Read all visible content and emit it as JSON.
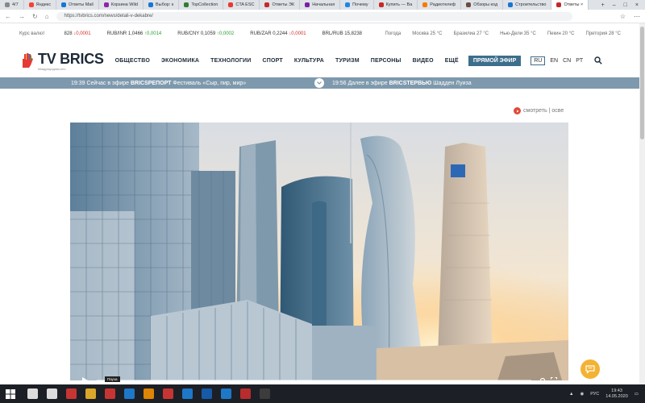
{
  "browser": {
    "tabs": [
      {
        "label": "4/7",
        "color": "#888888"
      },
      {
        "label": "Яндекс",
        "color": "#f44336"
      },
      {
        "label": "Ответы Mail",
        "color": "#1976d2"
      },
      {
        "label": "Корзина Wild",
        "color": "#8e24aa"
      },
      {
        "label": "Выбор: к",
        "color": "#1976d2"
      },
      {
        "label": "TopCollection",
        "color": "#2e7d32"
      },
      {
        "label": "CTA ESC",
        "color": "#e53935"
      },
      {
        "label": "Ответы ЭК",
        "color": "#c62828"
      },
      {
        "label": "Начальная",
        "color": "#7b1fa2"
      },
      {
        "label": "Почему",
        "color": "#1e88e5"
      },
      {
        "label": "Купить — Ва",
        "color": "#c62828"
      },
      {
        "label": "Радиотелеф",
        "color": "#f57c00"
      },
      {
        "label": "Обзоры код",
        "color": "#6d4c41"
      },
      {
        "label": "Строительство",
        "color": "#1976d2"
      },
      {
        "label": "Ответы ×",
        "color": "#c62828",
        "active": true
      }
    ],
    "url": "https://tvbrics.com/news/detali-v-dekabre/"
  },
  "rates": {
    "label": "Курс валют",
    "items": [
      {
        "code": "828",
        "delta": "↓0,0001",
        "dir": "down"
      },
      {
        "code": "RUB/INR 1,0466",
        "delta": "↑0,0014",
        "dir": "up"
      },
      {
        "code": "RUB/CNY 0,1059",
        "delta": "↑0,0002",
        "dir": "up"
      },
      {
        "code": "RUB/ZAR 0,2244",
        "delta": "↓0,0001",
        "dir": "down"
      },
      {
        "code": "BRL/RUB 15,8238",
        "delta": "",
        "dir": ""
      }
    ],
    "weather_label": "Погода",
    "weather": [
      "Москва 25 °C",
      "Бразилиа 27 °C",
      "Нью-Дели 35 °C",
      "Пекин 20 °C",
      "Претория 28 °C"
    ]
  },
  "header": {
    "logo_text": "TV BRICS",
    "logo_sub": "Международная сеть",
    "menu": [
      "ОБЩЕСТВО",
      "ЭКОНОМИКА",
      "ТЕХНОЛОГИИ",
      "СПОРТ",
      "КУЛЬТУРА",
      "ТУРИЗМ",
      "ПЕРСОНЫ",
      "ВИДЕО",
      "ЕЩЁ"
    ],
    "live_label": "ПРЯМОЙ ЭФИР",
    "langs": [
      "RU",
      "EN",
      "CN",
      "PT"
    ]
  },
  "ticker": {
    "left_time": "19:39",
    "left_text": "Сейчас в эфире",
    "left_channel": "BRICSРЕПОРТ",
    "left_show": "Фестиваль «Сыр, пир, мир»",
    "right_time": "19:56",
    "right_text": "Далее в эфире",
    "right_channel": "BRICSТЕРВЬЮ",
    "right_show": "Шадден Луиза"
  },
  "share_label": "смотреть | осве",
  "video": {
    "label": "Пауза"
  },
  "taskbar": {
    "icons": [
      {
        "name": "search-icon",
        "color": "#ffffff"
      },
      {
        "name": "task-view-icon",
        "color": "#ffffff"
      },
      {
        "name": "opera-icon",
        "color": "#e53935"
      },
      {
        "name": "explorer-icon",
        "color": "#fbc02d"
      },
      {
        "name": "media-icon",
        "color": "#e53935"
      },
      {
        "name": "store-icon",
        "color": "#1e88e5"
      },
      {
        "name": "firefox-icon",
        "color": "#ff9800"
      },
      {
        "name": "yandex-icon",
        "color": "#e53935"
      },
      {
        "name": "photos-icon",
        "color": "#1e88e5"
      },
      {
        "name": "word-icon",
        "color": "#1565c0"
      },
      {
        "name": "mail-icon",
        "color": "#1e88e5"
      },
      {
        "name": "pdf-icon",
        "color": "#d32f2f"
      },
      {
        "name": "terminal-icon",
        "color": "#424242"
      }
    ],
    "lang": "РУС",
    "time": "19:43",
    "date": "14.05.2020"
  }
}
